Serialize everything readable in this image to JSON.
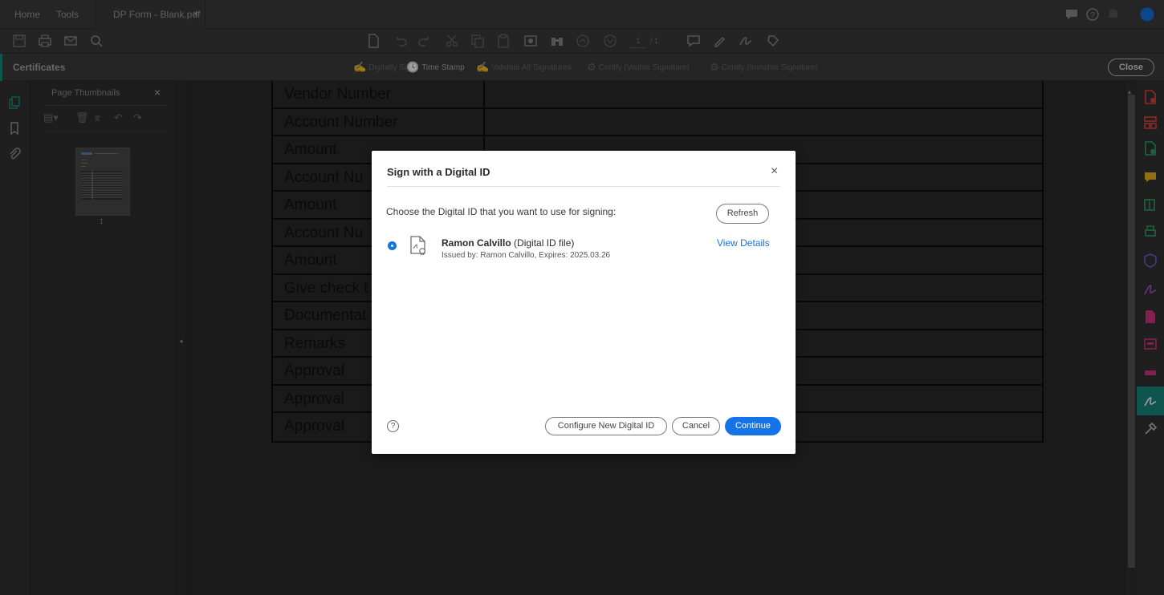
{
  "tabs": {
    "home": "Home",
    "tools": "Tools",
    "document": "DP Form - Blank.pdf",
    "close_glyph": "×"
  },
  "toolbar": {
    "page_current": "1",
    "page_total": "/ 1"
  },
  "certificates_bar": {
    "title": "Certificates",
    "items": [
      {
        "label": "Digitally Sign",
        "enabled": false,
        "icon": "pen-sign-icon"
      },
      {
        "label": "Time Stamp",
        "enabled": true,
        "icon": "time-stamp-icon"
      },
      {
        "label": "Validate All Signatures",
        "enabled": false,
        "icon": "validate-icon"
      },
      {
        "label": "Certify (Visible Signature)",
        "enabled": false,
        "icon": "certify-visible-icon"
      },
      {
        "label": "Certify (Invisible Signature)",
        "enabled": false,
        "icon": "certify-invisible-icon"
      }
    ],
    "close_label": "Close"
  },
  "thumbnails": {
    "title": "Page Thumbnails",
    "close_glyph": "×",
    "page_label": "1"
  },
  "form": {
    "rows": [
      "Vendor Number",
      "Account Number",
      "Amount",
      "Account Nu",
      "Amount",
      "Account Nu",
      "Amount",
      "Give check t",
      "Documentat",
      "Remarks",
      "Approval",
      "Approval",
      "Approval"
    ]
  },
  "dialog": {
    "title": "Sign with a Digital ID",
    "close_glyph": "×",
    "prompt": "Choose the Digital ID that you want to use for signing:",
    "refresh_label": "Refresh",
    "digital_id": {
      "name": "Ramon Calvillo",
      "type": "(Digital ID file)",
      "issued": "Issued by: Ramon Calvillo, Expires: 2025.03.26",
      "selected": true
    },
    "view_details_label": "View Details",
    "help_glyph": "?",
    "configure_label": "Configure New Digital ID",
    "cancel_label": "Cancel",
    "continue_label": "Continue"
  },
  "colors": {
    "accent_teal": "#1a8a7c",
    "primary_blue": "#1473e6"
  }
}
